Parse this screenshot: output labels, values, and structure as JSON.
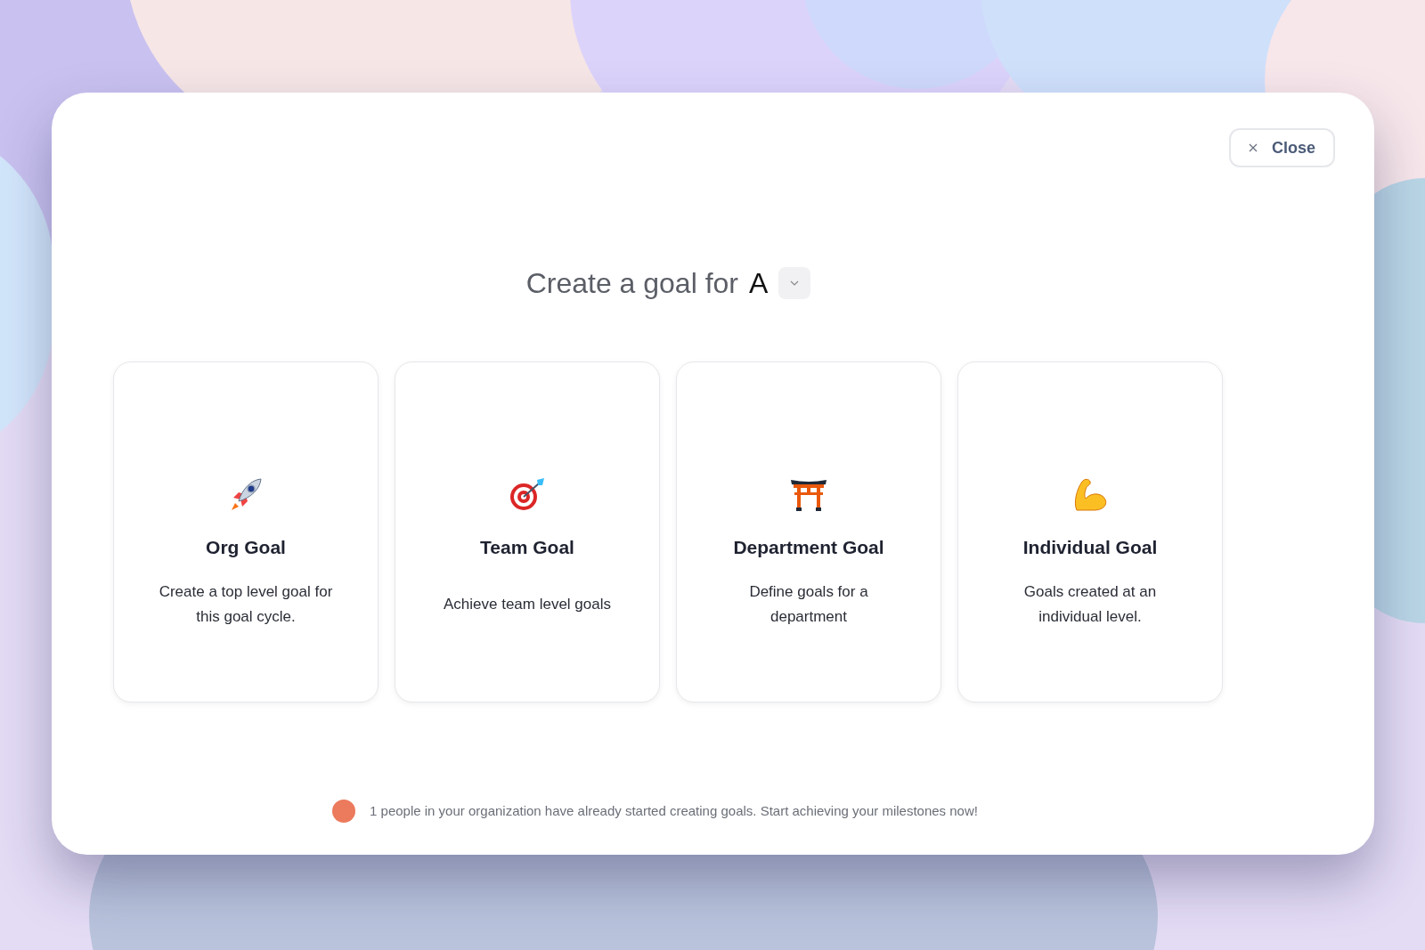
{
  "close_button": {
    "label": "Close"
  },
  "heading": {
    "text": "Create a goal for",
    "value": "A"
  },
  "goal_types": [
    {
      "title": "Org Goal",
      "description": "Create a top level goal for this goal cycle."
    },
    {
      "title": "Team Goal",
      "description": "Achieve team level goals"
    },
    {
      "title": "Department Goal",
      "description": "Define goals for a department"
    },
    {
      "title": "Individual Goal",
      "description": "Goals created at an individual level."
    }
  ],
  "footer_note": "1 people in your organization have already started creating goals. Start achieving your milestones now!"
}
